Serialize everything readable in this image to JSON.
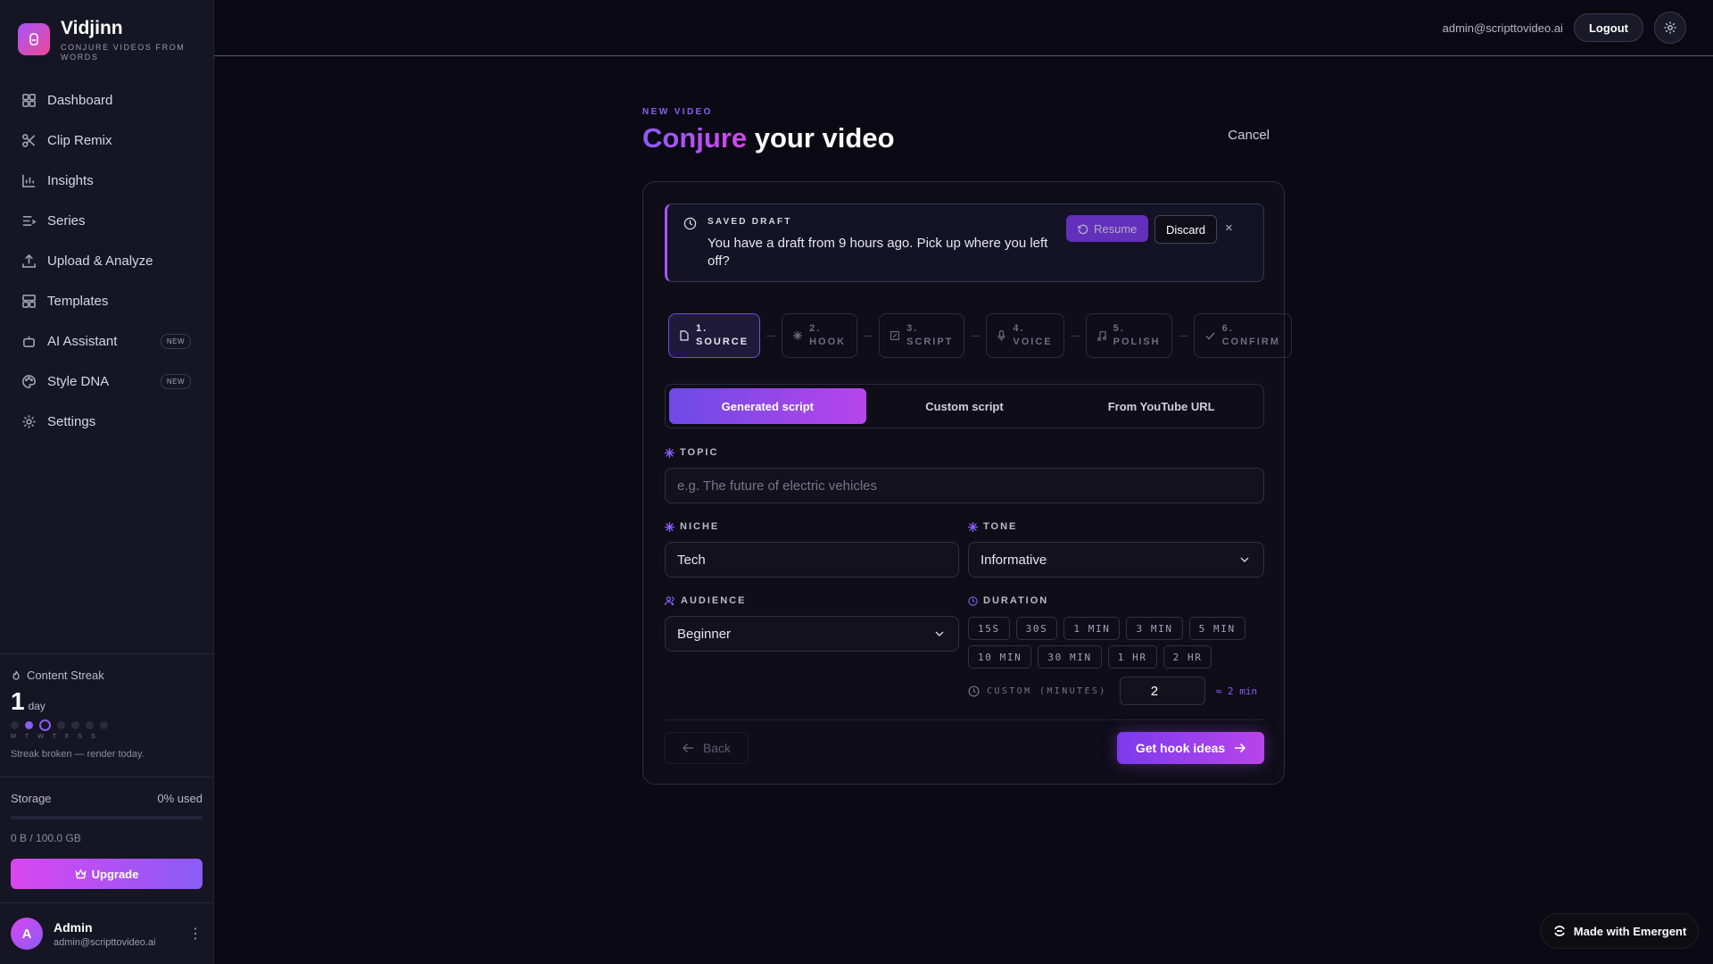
{
  "brand": {
    "name": "Vidjinn",
    "tagline": "CONJURE VIDEOS FROM WORDS"
  },
  "nav": [
    {
      "label": "Dashboard",
      "icon": "dashboard-icon"
    },
    {
      "label": "Clip Remix",
      "icon": "scissors-icon"
    },
    {
      "label": "Insights",
      "icon": "bar-chart-icon"
    },
    {
      "label": "Series",
      "icon": "list-icon"
    },
    {
      "label": "Upload & Analyze",
      "icon": "upload-icon"
    },
    {
      "label": "Templates",
      "icon": "template-icon"
    },
    {
      "label": "AI Assistant",
      "icon": "robot-icon",
      "badge": "NEW"
    },
    {
      "label": "Style DNA",
      "icon": "palette-icon",
      "badge": "NEW"
    },
    {
      "label": "Settings",
      "icon": "gear-icon"
    }
  ],
  "streak": {
    "label": "Content Streak",
    "count": "1",
    "unit": "day",
    "days": [
      "M",
      "T",
      "W",
      "T",
      "F",
      "S",
      "S"
    ],
    "note": "Streak broken — render today."
  },
  "storage": {
    "label": "Storage",
    "used_pct": "0% used",
    "detail": "0 B / 100.0 GB",
    "used_fraction": 0,
    "upgrade": "Upgrade"
  },
  "user": {
    "initial": "A",
    "name": "Admin",
    "email": "admin@scripttovideo.ai"
  },
  "topbar": {
    "email": "admin@scripttovideo.ai",
    "logout": "Logout"
  },
  "page": {
    "eyebrow": "NEW VIDEO",
    "title_accent": "Conjure",
    "title_rest": "your video",
    "cancel": "Cancel"
  },
  "draft": {
    "label": "SAVED DRAFT",
    "text": "You have a draft from 9 hours ago. Pick up where you left off?",
    "resume": "Resume",
    "discard": "Discard",
    "close": "×"
  },
  "steps": [
    {
      "num": "1.",
      "label": "SOURCE",
      "active": true
    },
    {
      "num": "2.",
      "label": "HOOK"
    },
    {
      "num": "3.",
      "label": "SCRIPT"
    },
    {
      "num": "4.",
      "label": "VOICE"
    },
    {
      "num": "5.",
      "label": "POLISH"
    },
    {
      "num": "6.",
      "label": "CONFIRM"
    }
  ],
  "mode_tabs": [
    "Generated script",
    "Custom script",
    "From YouTube URL"
  ],
  "form": {
    "topic_label": "TOPIC",
    "topic_placeholder": "e.g. The future of electric vehicles",
    "niche_label": "NICHE",
    "niche_value": "Tech",
    "tone_label": "TONE",
    "tone_value": "Informative",
    "audience_label": "AUDIENCE",
    "audience_value": "Beginner",
    "duration_label": "DURATION",
    "durations": [
      "15S",
      "30S",
      "1 MIN",
      "3 MIN",
      "5 MIN",
      "10 MIN",
      "30 MIN",
      "1 HR",
      "2 HR"
    ],
    "custom_label": "CUSTOM (MINUTES)",
    "custom_value": "2",
    "custom_approx": "≈ 2 min"
  },
  "actions": {
    "back": "Back",
    "next": "Get hook ideas"
  },
  "footer_badge": "Made with Emergent",
  "colors": {
    "accent": "#8b5cf6",
    "pink": "#d946ef",
    "bg": "#0b0a14"
  }
}
